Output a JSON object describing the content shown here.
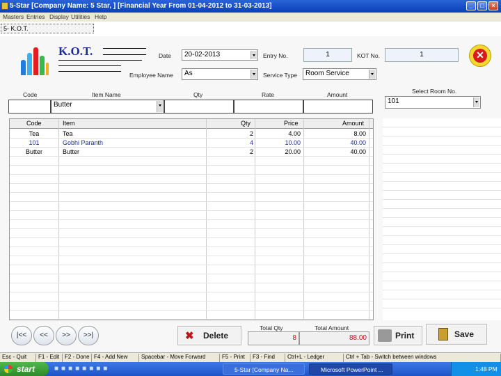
{
  "window": {
    "title": "5-Star [Company Name: 5 Star, ] [Financial Year From 01-04-2012 to 31-03-2013]",
    "min": "_",
    "max": "□",
    "close": "×"
  },
  "menu": [
    "Masters",
    "Entries",
    "Display",
    "Utilities",
    "Help"
  ],
  "child_tab": {
    "label": "5- K.O.T."
  },
  "form": {
    "heading": "K.O.T.",
    "date_label": "Date",
    "date_value": "20-02-2013",
    "entry_no_label": "Entry No.",
    "entry_no_value": "1",
    "kot_no_label": "KOT No.",
    "kot_no_value": "1",
    "employee_label": "Employee Name",
    "employee_value": "As",
    "service_type_label": "Service Type",
    "service_type_value": "Room Service",
    "entry_headers": {
      "code": "Code",
      "item_name": "Item Name",
      "qty": "Qty",
      "rate": "Rate",
      "amount": "Amount"
    },
    "entry_row": {
      "code": "",
      "item_name": "Butter",
      "qty": "",
      "rate": "",
      "amount": ""
    },
    "select_room_label": "Select Room No.",
    "select_room_value": "101"
  },
  "grid": {
    "headers": {
      "code": "Code",
      "item": "Item",
      "qty": "Qty",
      "price": "Price",
      "amount": "Amount"
    },
    "rows": [
      {
        "code": "Tea",
        "item": "Tea",
        "qty": "2",
        "price": "4.00",
        "amount": "8.00"
      },
      {
        "code": "101",
        "item": "Gobhi Paranth",
        "qty": "4",
        "price": "10.00",
        "amount": "40.00"
      },
      {
        "code": "Butter",
        "item": "Butter",
        "qty": "2",
        "price": "20.00",
        "amount": "40.00"
      }
    ]
  },
  "nav": {
    "first": "|<<",
    "prev": "<<",
    "next": ">>",
    "last": ">>|"
  },
  "actions": {
    "delete": "Delete",
    "print": "Print",
    "save": "Save"
  },
  "totals": {
    "total_qty_label": "Total Qty",
    "total_qty_value": "8",
    "total_amount_label": "Total Amount",
    "total_amount_value": "88.00"
  },
  "statusbar": [
    "Esc - Quit",
    "F1 - Edit",
    "F2 - Done",
    "F4 - Add New",
    "Spacebar - Move Forward",
    "F5 - Print",
    "F3 - Find",
    "Ctrl+L - Ledger",
    "Ctrl + Tab - Switch between windows"
  ],
  "taskbar": {
    "start": "start",
    "tasks": [
      "5-Star [Company Na...",
      "Microsoft PowerPoint ..."
    ],
    "clock": "1:48 PM"
  },
  "colors": {
    "title_blue": "#0a3fb8",
    "accent_red": "#c0151b",
    "logo_red": "#e02020"
  }
}
